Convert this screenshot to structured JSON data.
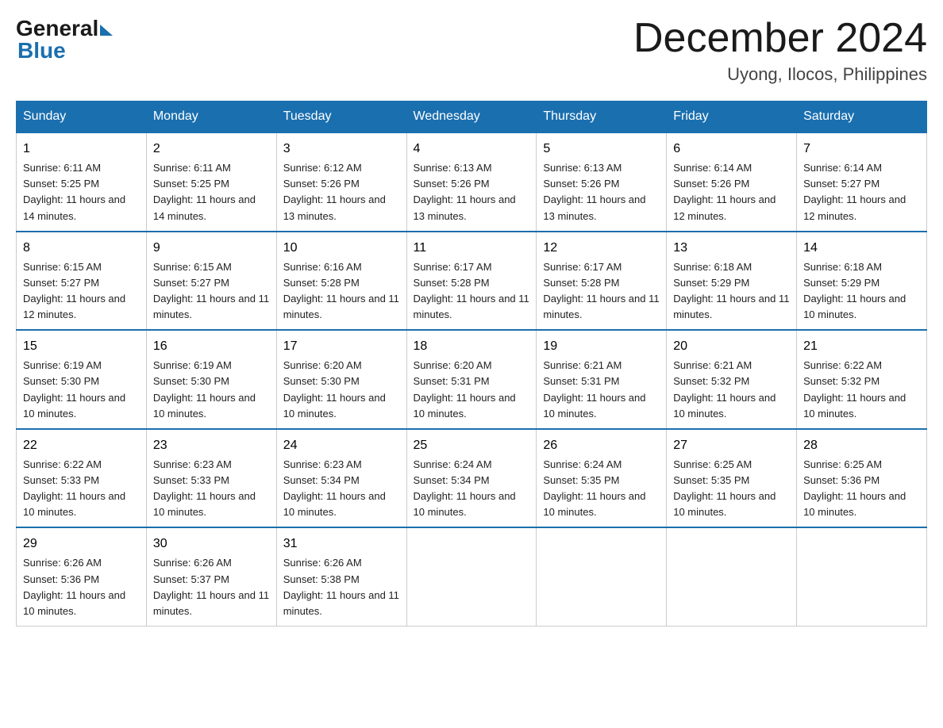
{
  "header": {
    "logo_general": "General",
    "logo_blue": "Blue",
    "month_title": "December 2024",
    "location": "Uyong, Ilocos, Philippines"
  },
  "days_of_week": [
    "Sunday",
    "Monday",
    "Tuesday",
    "Wednesday",
    "Thursday",
    "Friday",
    "Saturday"
  ],
  "weeks": [
    [
      {
        "day": "1",
        "sunrise": "6:11 AM",
        "sunset": "5:25 PM",
        "daylight": "11 hours and 14 minutes."
      },
      {
        "day": "2",
        "sunrise": "6:11 AM",
        "sunset": "5:25 PM",
        "daylight": "11 hours and 14 minutes."
      },
      {
        "day": "3",
        "sunrise": "6:12 AM",
        "sunset": "5:26 PM",
        "daylight": "11 hours and 13 minutes."
      },
      {
        "day": "4",
        "sunrise": "6:13 AM",
        "sunset": "5:26 PM",
        "daylight": "11 hours and 13 minutes."
      },
      {
        "day": "5",
        "sunrise": "6:13 AM",
        "sunset": "5:26 PM",
        "daylight": "11 hours and 13 minutes."
      },
      {
        "day": "6",
        "sunrise": "6:14 AM",
        "sunset": "5:26 PM",
        "daylight": "11 hours and 12 minutes."
      },
      {
        "day": "7",
        "sunrise": "6:14 AM",
        "sunset": "5:27 PM",
        "daylight": "11 hours and 12 minutes."
      }
    ],
    [
      {
        "day": "8",
        "sunrise": "6:15 AM",
        "sunset": "5:27 PM",
        "daylight": "11 hours and 12 minutes."
      },
      {
        "day": "9",
        "sunrise": "6:15 AM",
        "sunset": "5:27 PM",
        "daylight": "11 hours and 11 minutes."
      },
      {
        "day": "10",
        "sunrise": "6:16 AM",
        "sunset": "5:28 PM",
        "daylight": "11 hours and 11 minutes."
      },
      {
        "day": "11",
        "sunrise": "6:17 AM",
        "sunset": "5:28 PM",
        "daylight": "11 hours and 11 minutes."
      },
      {
        "day": "12",
        "sunrise": "6:17 AM",
        "sunset": "5:28 PM",
        "daylight": "11 hours and 11 minutes."
      },
      {
        "day": "13",
        "sunrise": "6:18 AM",
        "sunset": "5:29 PM",
        "daylight": "11 hours and 11 minutes."
      },
      {
        "day": "14",
        "sunrise": "6:18 AM",
        "sunset": "5:29 PM",
        "daylight": "11 hours and 10 minutes."
      }
    ],
    [
      {
        "day": "15",
        "sunrise": "6:19 AM",
        "sunset": "5:30 PM",
        "daylight": "11 hours and 10 minutes."
      },
      {
        "day": "16",
        "sunrise": "6:19 AM",
        "sunset": "5:30 PM",
        "daylight": "11 hours and 10 minutes."
      },
      {
        "day": "17",
        "sunrise": "6:20 AM",
        "sunset": "5:30 PM",
        "daylight": "11 hours and 10 minutes."
      },
      {
        "day": "18",
        "sunrise": "6:20 AM",
        "sunset": "5:31 PM",
        "daylight": "11 hours and 10 minutes."
      },
      {
        "day": "19",
        "sunrise": "6:21 AM",
        "sunset": "5:31 PM",
        "daylight": "11 hours and 10 minutes."
      },
      {
        "day": "20",
        "sunrise": "6:21 AM",
        "sunset": "5:32 PM",
        "daylight": "11 hours and 10 minutes."
      },
      {
        "day": "21",
        "sunrise": "6:22 AM",
        "sunset": "5:32 PM",
        "daylight": "11 hours and 10 minutes."
      }
    ],
    [
      {
        "day": "22",
        "sunrise": "6:22 AM",
        "sunset": "5:33 PM",
        "daylight": "11 hours and 10 minutes."
      },
      {
        "day": "23",
        "sunrise": "6:23 AM",
        "sunset": "5:33 PM",
        "daylight": "11 hours and 10 minutes."
      },
      {
        "day": "24",
        "sunrise": "6:23 AM",
        "sunset": "5:34 PM",
        "daylight": "11 hours and 10 minutes."
      },
      {
        "day": "25",
        "sunrise": "6:24 AM",
        "sunset": "5:34 PM",
        "daylight": "11 hours and 10 minutes."
      },
      {
        "day": "26",
        "sunrise": "6:24 AM",
        "sunset": "5:35 PM",
        "daylight": "11 hours and 10 minutes."
      },
      {
        "day": "27",
        "sunrise": "6:25 AM",
        "sunset": "5:35 PM",
        "daylight": "11 hours and 10 minutes."
      },
      {
        "day": "28",
        "sunrise": "6:25 AM",
        "sunset": "5:36 PM",
        "daylight": "11 hours and 10 minutes."
      }
    ],
    [
      {
        "day": "29",
        "sunrise": "6:26 AM",
        "sunset": "5:36 PM",
        "daylight": "11 hours and 10 minutes."
      },
      {
        "day": "30",
        "sunrise": "6:26 AM",
        "sunset": "5:37 PM",
        "daylight": "11 hours and 11 minutes."
      },
      {
        "day": "31",
        "sunrise": "6:26 AM",
        "sunset": "5:38 PM",
        "daylight": "11 hours and 11 minutes."
      },
      null,
      null,
      null,
      null
    ]
  ]
}
